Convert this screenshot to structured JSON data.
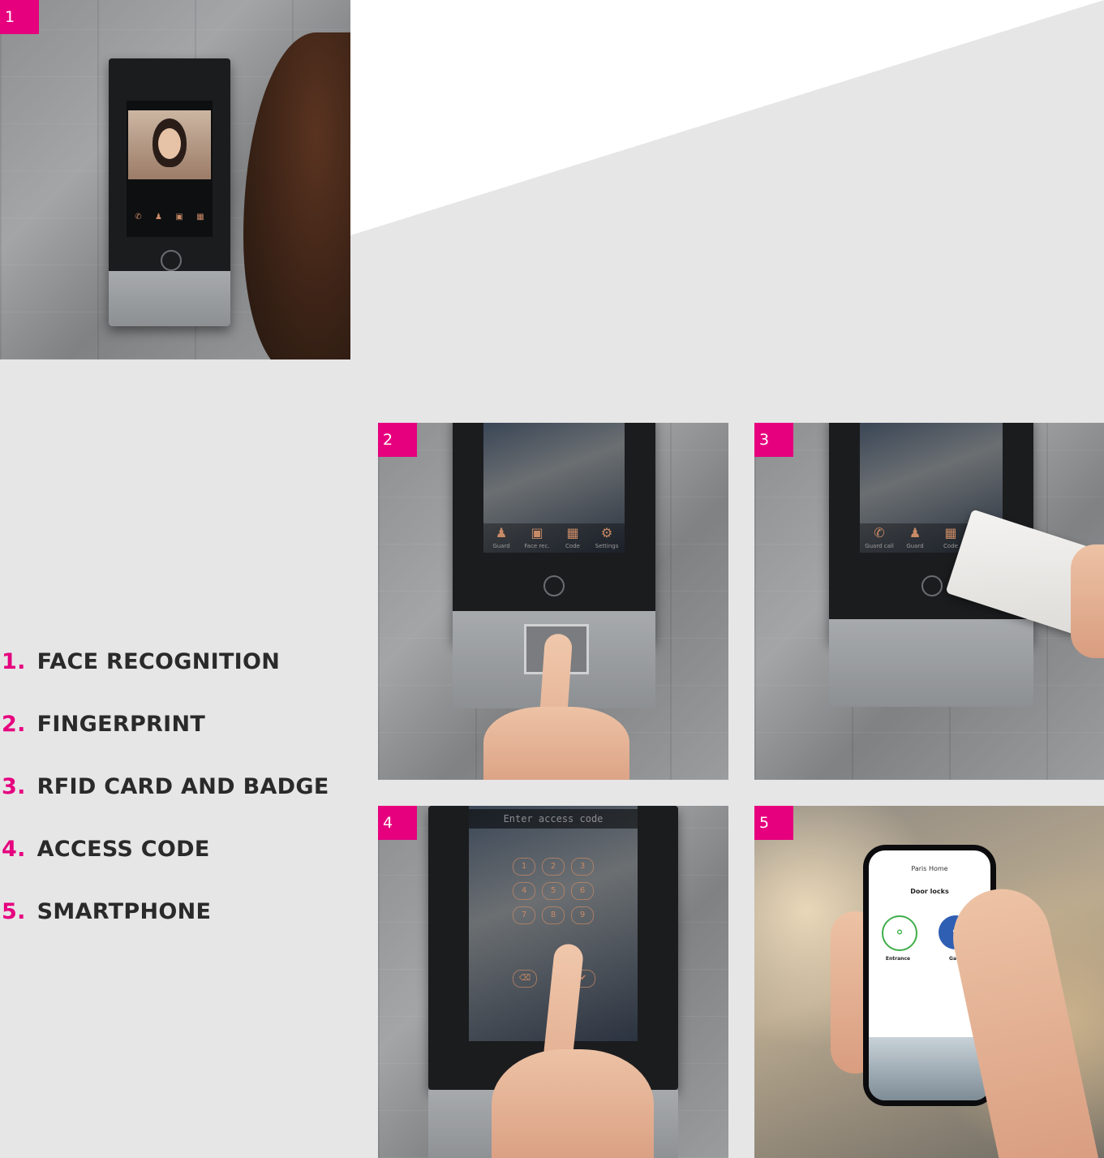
{
  "badges": [
    "1",
    "2",
    "3",
    "4",
    "5"
  ],
  "features": [
    {
      "number": "1.",
      "label": "FACE RECOGNITION"
    },
    {
      "number": "2.",
      "label": "FINGERPRINT"
    },
    {
      "number": "3.",
      "label": "RFID CARD AND BADGE"
    },
    {
      "number": "4.",
      "label": "ACCESS CODE"
    },
    {
      "number": "5.",
      "label": "SMARTPHONE"
    }
  ],
  "device_menu_2": [
    "Guard",
    "Face rec.",
    "Code",
    "Settings"
  ],
  "device_menu_3": [
    "Guard call",
    "Guard",
    "Code"
  ],
  "keypad": {
    "prompt": "Enter access code",
    "keys": [
      "1",
      "2",
      "3",
      "4",
      "5",
      "6",
      "7",
      "8",
      "9"
    ]
  },
  "app": {
    "header": "Paris Home",
    "section": "Door locks",
    "locks": [
      {
        "name": "Entrance",
        "color": "#3fae49"
      },
      {
        "name": "Gate",
        "color": "#2f5fb3"
      }
    ]
  },
  "colors": {
    "accent": "#e6007e",
    "background": "#e6e6e7"
  }
}
